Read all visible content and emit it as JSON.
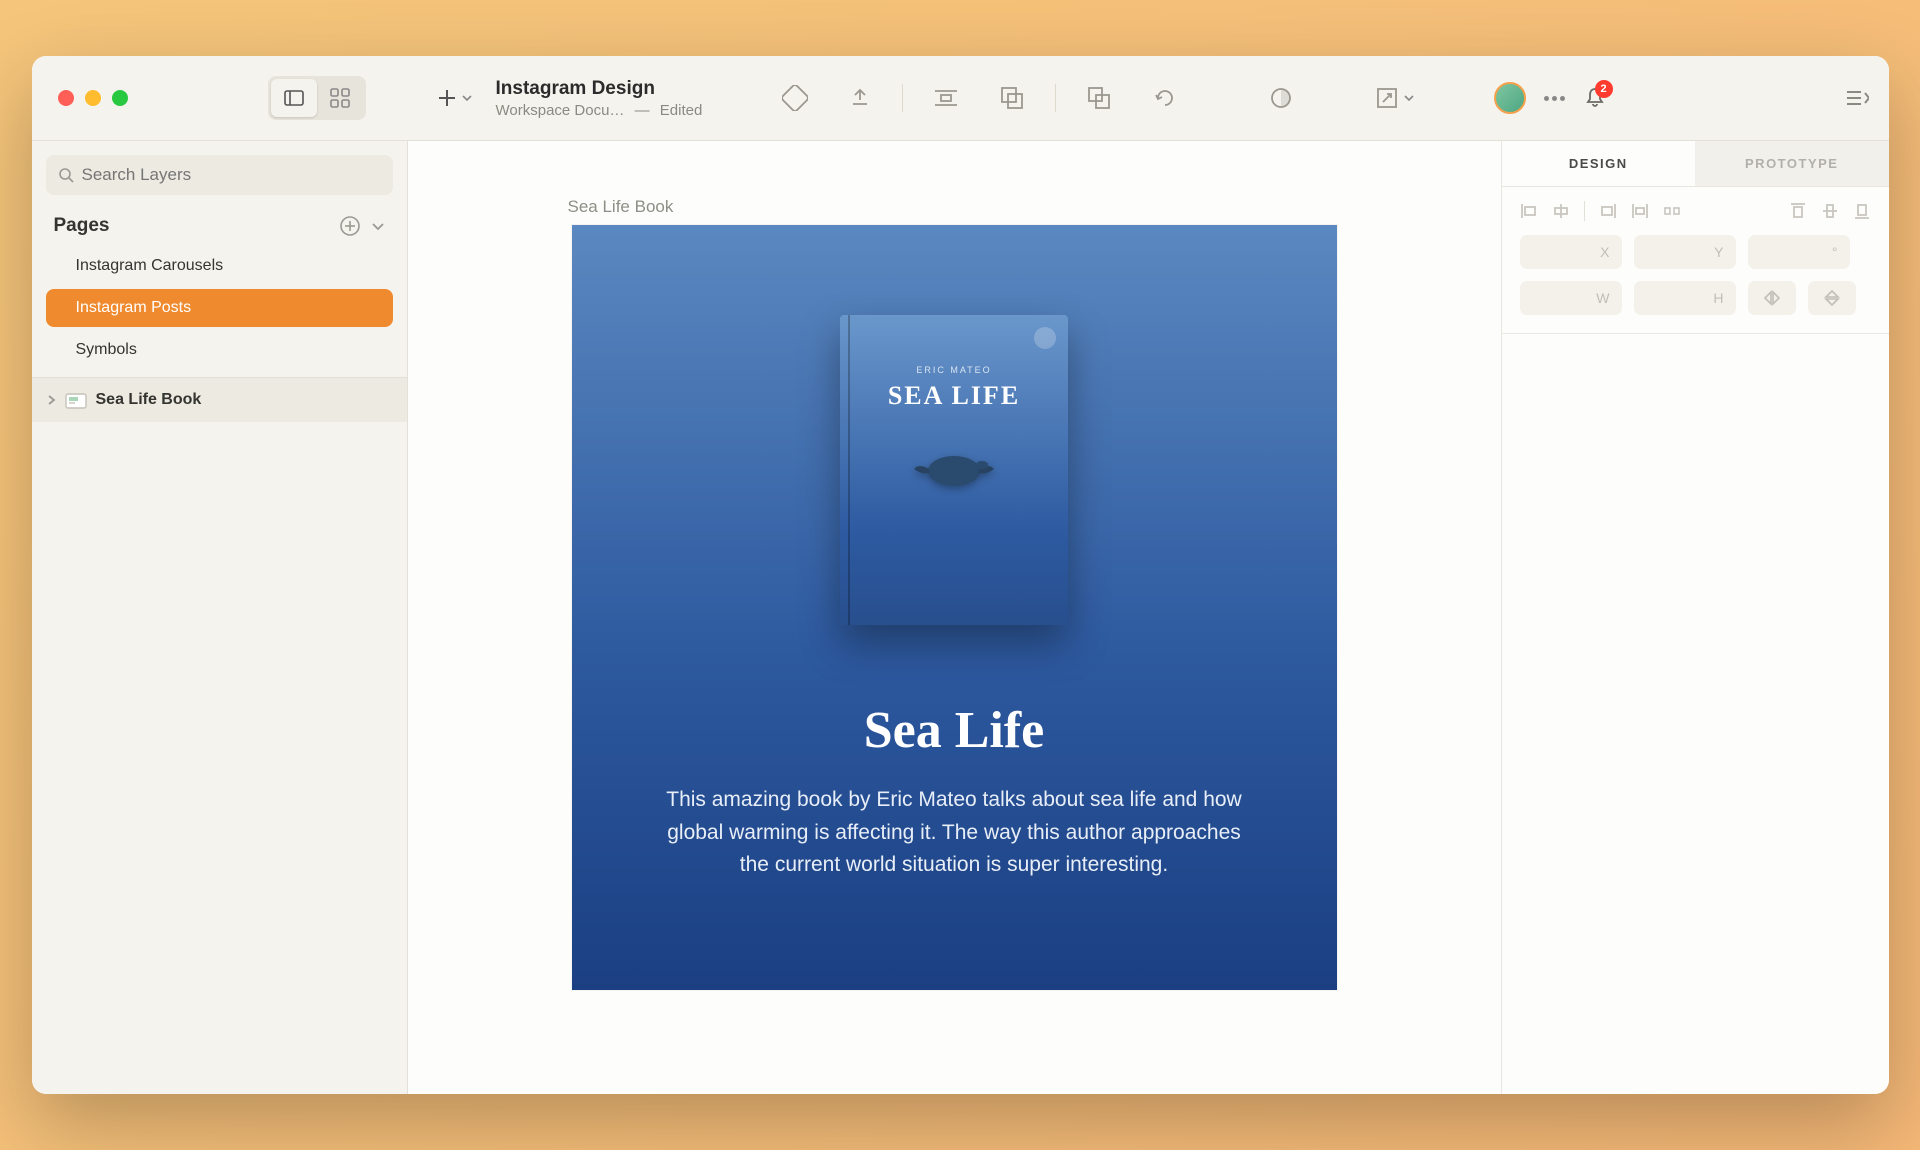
{
  "document": {
    "title": "Instagram Design",
    "subtitle_prefix": "Workspace Docu…",
    "subtitle_dash": "—",
    "subtitle_status": "Edited"
  },
  "sidebar": {
    "search_placeholder": "Search Layers",
    "pages_label": "Pages",
    "pages": [
      {
        "label": "Instagram Carousels"
      },
      {
        "label": "Instagram Posts"
      },
      {
        "label": "Symbols"
      }
    ],
    "layer": {
      "label": "Sea Life Book"
    }
  },
  "canvas": {
    "artboard_label": "Sea Life Book",
    "book_author": "ERIC MATEO",
    "book_title": "SEA LIFE",
    "hero_title": "Sea Life",
    "hero_desc": "This amazing book by Eric Mateo talks about sea life and how global warming is affecting it. The way this author approaches the current world situation is super interesting."
  },
  "inspector": {
    "tabs": {
      "design": "DESIGN",
      "prototype": "PROTOTYPE"
    },
    "fields": {
      "x": "X",
      "y": "Y",
      "deg": "°",
      "w": "W",
      "h": "H"
    }
  },
  "notifications": {
    "count": "2"
  }
}
